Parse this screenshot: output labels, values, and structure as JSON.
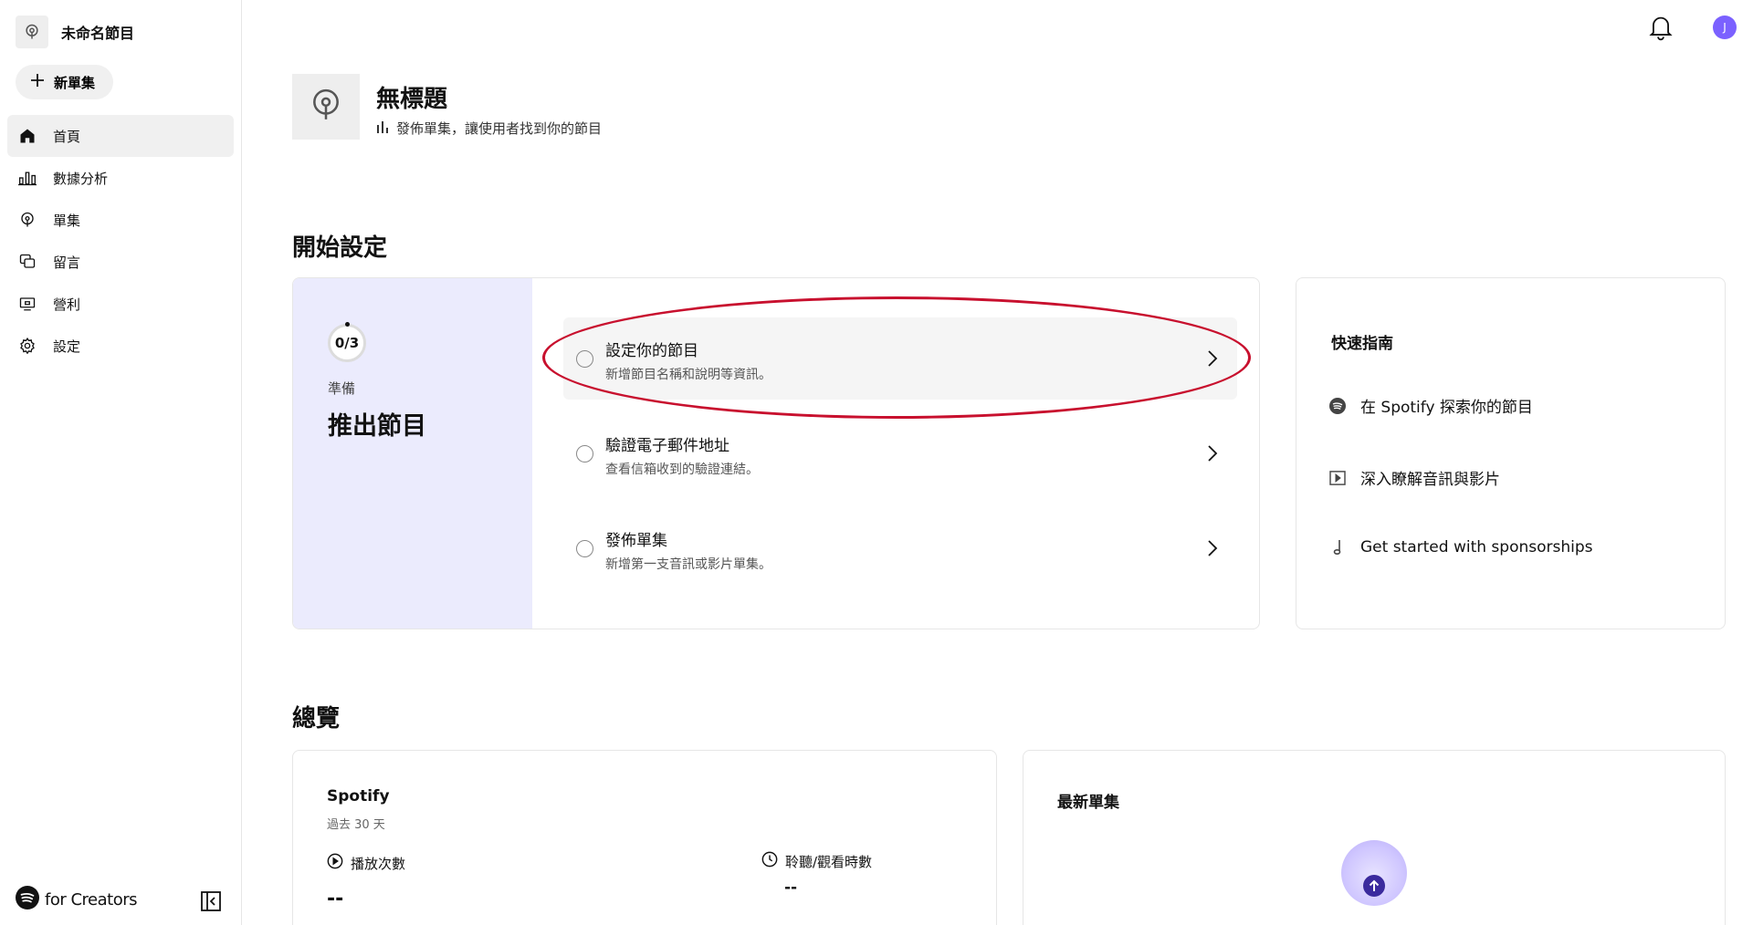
{
  "sidebar": {
    "show_name": "未命名節目",
    "new_episode": "新單集",
    "items": [
      {
        "label": "首頁",
        "icon": "home-icon"
      },
      {
        "label": "數據分析",
        "icon": "analytics-icon"
      },
      {
        "label": "單集",
        "icon": "episodes-icon"
      },
      {
        "label": "留言",
        "icon": "comments-icon"
      },
      {
        "label": "營利",
        "icon": "monetization-icon"
      },
      {
        "label": "設定",
        "icon": "settings-icon"
      }
    ],
    "brand": "for Creators"
  },
  "topbar": {
    "avatar_initial": "J"
  },
  "header": {
    "title": "無標題",
    "subtitle": "發佈單集，讓使用者找到你的節目"
  },
  "setup": {
    "section_title": "開始設定",
    "progress": "0/3",
    "ready": "準備",
    "launch": "推出節目",
    "tasks": [
      {
        "title": "設定你的節目",
        "desc": "新增節目名稱和說明等資訊。"
      },
      {
        "title": "驗證電子郵件地址",
        "desc": "查看信箱收到的驗證連結。"
      },
      {
        "title": "發佈單集",
        "desc": "新增第一支音訊或影片單集。"
      }
    ]
  },
  "guide": {
    "title": "快速指南",
    "items": [
      {
        "label": "在 Spotify 探索你的節目",
        "icon": "spotify-icon"
      },
      {
        "label": "深入瞭解音訊與影片",
        "icon": "video-icon"
      },
      {
        "label": "Get started with sponsorships",
        "icon": "music-note-icon"
      }
    ]
  },
  "overview": {
    "section_title": "總覽",
    "spotify_title": "Spotify",
    "spotify_range": "過去 30 天",
    "plays_label": "播放次數",
    "plays_value": "--",
    "time_label": "聆聽/觀看時數",
    "time_value": "--",
    "latest_title": "最新單集"
  },
  "colors": {
    "accent": "#7b61ff",
    "annotation": "#c8102e",
    "setup_bg": "#ebebfd"
  }
}
